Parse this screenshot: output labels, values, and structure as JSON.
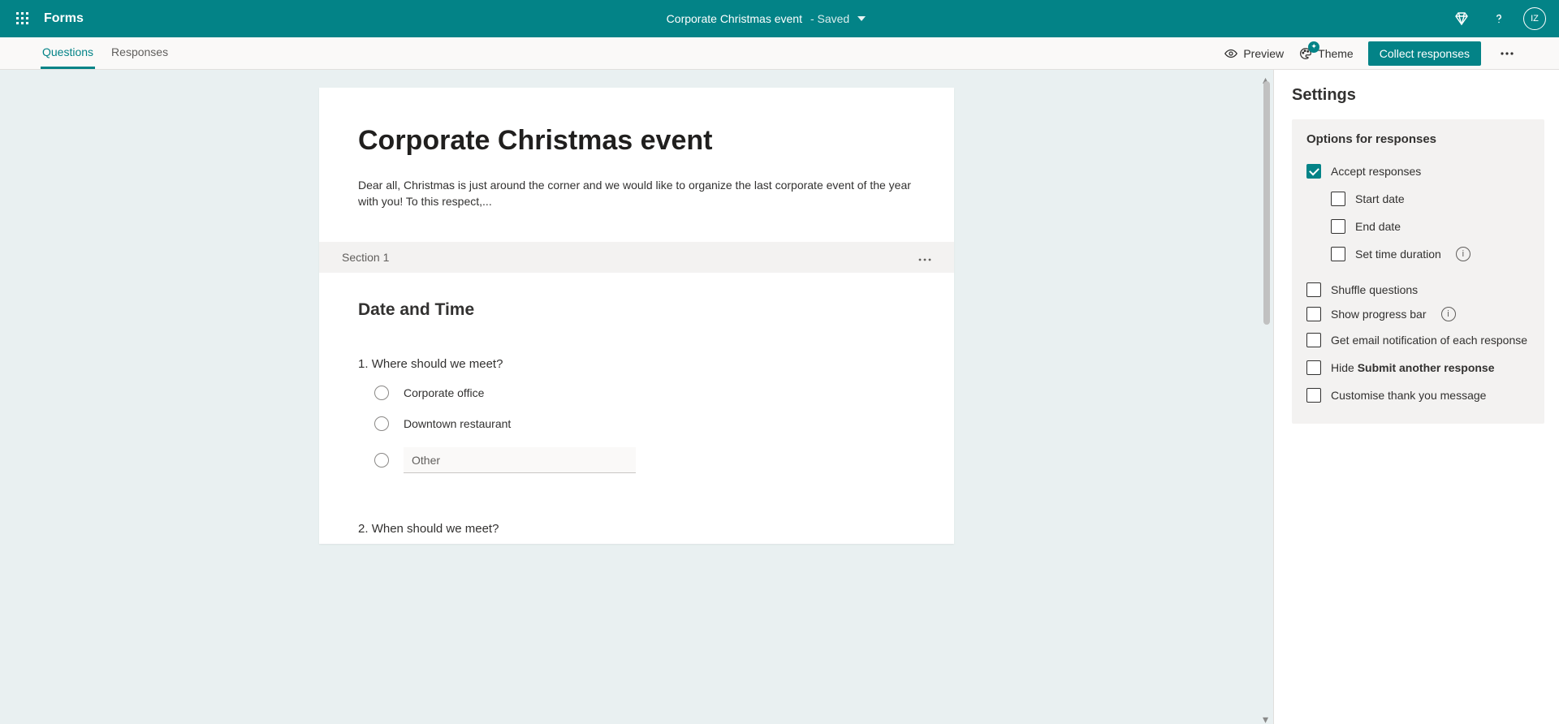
{
  "header": {
    "brand": "Forms",
    "form_name": "Corporate Christmas event",
    "saved_state": "-  Saved",
    "avatar_initials": "IZ"
  },
  "command_bar": {
    "tabs": {
      "questions": "Questions",
      "responses": "Responses"
    },
    "active_tab": "questions",
    "preview": "Preview",
    "theme": "Theme",
    "collect": "Collect responses"
  },
  "form": {
    "title": "Corporate Christmas event",
    "description": "Dear all, Christmas is just around the corner and we would like to organize the last corporate event of the year with you! To this respect,...",
    "section_label": "Section 1",
    "section_title": "Date and Time",
    "questions": [
      {
        "number": "1.",
        "text": "Where should we meet?",
        "options": [
          "Corporate office",
          "Downtown restaurant"
        ],
        "other_placeholder": "Other"
      },
      {
        "number": "2.",
        "text": "When should we meet?"
      }
    ]
  },
  "settings": {
    "title": "Settings",
    "options_title": "Options for responses",
    "accept_responses": "Accept responses",
    "start_date": "Start date",
    "end_date": "End date",
    "set_time_duration": "Set time duration",
    "shuffle_questions": "Shuffle questions",
    "show_progress": "Show progress bar",
    "email_notification": "Get email notification of each response",
    "hide_prefix": "Hide ",
    "hide_bold": "Submit another response",
    "customise_thank_you": "Customise thank you message"
  }
}
